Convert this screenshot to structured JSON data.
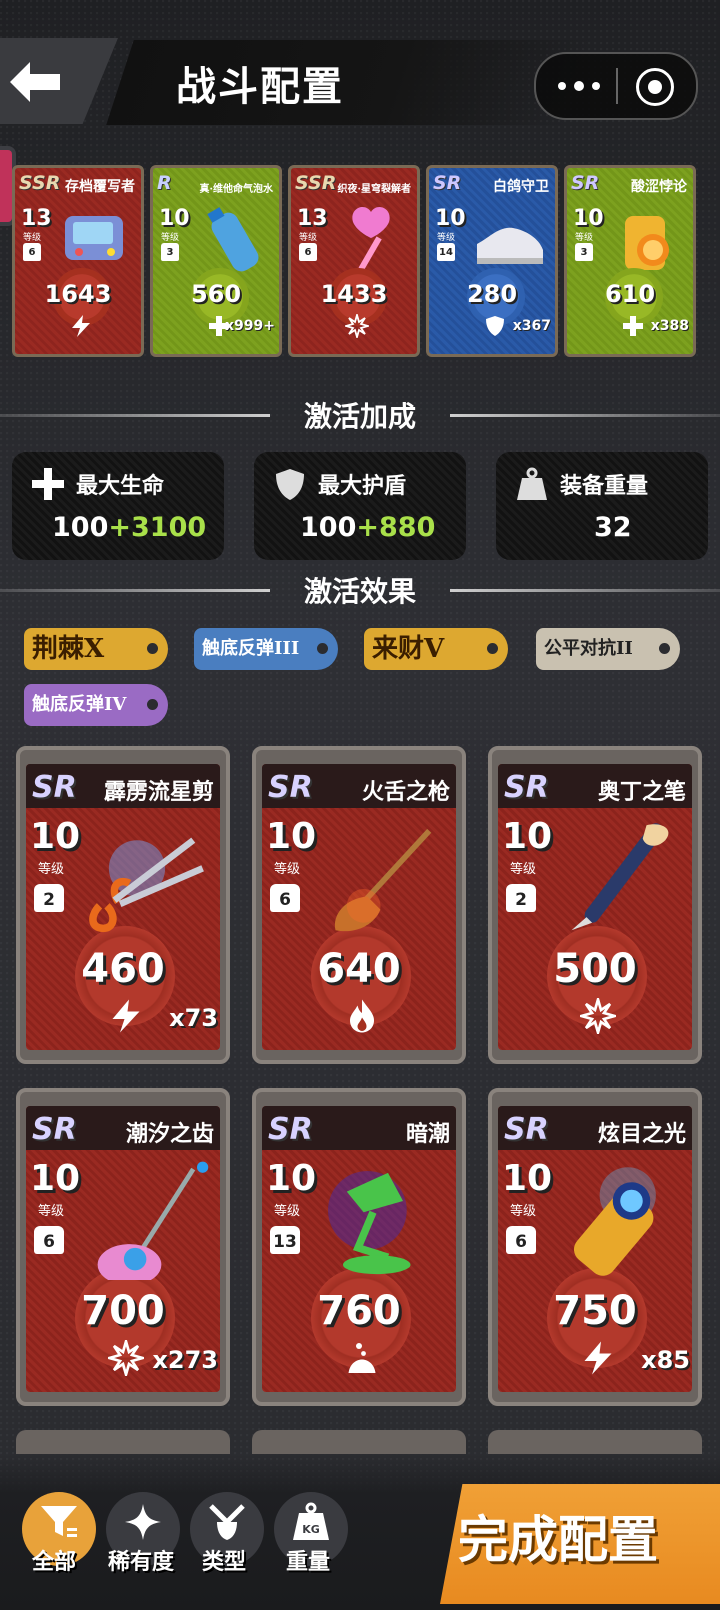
{
  "header": {
    "title": "战斗配置"
  },
  "equipped": [
    {
      "rarity": "SSR",
      "name": "存档覆写者",
      "level": "13",
      "level_label": "等级",
      "weight": "6",
      "value": "1643",
      "stat_icon": "lightning-icon",
      "count": "",
      "color": "red"
    },
    {
      "rarity": "R",
      "name": "真·维他命气泡水",
      "level": "10",
      "level_label": "等级",
      "weight": "3",
      "value": "560",
      "stat_icon": "plus-icon",
      "count": "x999+",
      "color": "green"
    },
    {
      "rarity": "SSR",
      "name": "织夜·星穹裂解者",
      "level": "13",
      "level_label": "等级",
      "weight": "6",
      "value": "1433",
      "stat_icon": "snowflake-icon",
      "count": "",
      "color": "red"
    },
    {
      "rarity": "SR",
      "name": "白鸽守卫",
      "level": "10",
      "level_label": "等级",
      "weight": "14",
      "value": "280",
      "stat_icon": "shield-icon",
      "count": "x367",
      "color": "blue"
    },
    {
      "rarity": "SR",
      "name": "酸涩悖论",
      "level": "10",
      "level_label": "等级",
      "weight": "3",
      "value": "610",
      "stat_icon": "plus-icon",
      "count": "x388",
      "color": "green"
    }
  ],
  "bonus_section": {
    "title": "激活加成"
  },
  "bonuses": [
    {
      "label": "最大生命",
      "base": "100",
      "plus": "+3100",
      "icon": "plus-icon"
    },
    {
      "label": "最大护盾",
      "base": "100",
      "plus": "+880",
      "icon": "shield-icon"
    },
    {
      "label": "装备重量",
      "base": "32",
      "plus": "",
      "icon": "weight-icon"
    }
  ],
  "effects_section": {
    "title": "激活效果"
  },
  "effects": [
    "荆棘X",
    "触底反弹III",
    "来财V",
    "公平对抗II",
    "触底反弹IV"
  ],
  "inventory": [
    {
      "rarity": "SR",
      "name": "霹雳流星剪",
      "level": "10",
      "level_label": "等级",
      "weight": "2",
      "value": "460",
      "stat_icon": "lightning-icon",
      "count": "x73"
    },
    {
      "rarity": "SR",
      "name": "火舌之枪",
      "level": "10",
      "level_label": "等级",
      "weight": "6",
      "value": "640",
      "stat_icon": "flame-icon",
      "count": ""
    },
    {
      "rarity": "SR",
      "name": "奥丁之笔",
      "level": "10",
      "level_label": "等级",
      "weight": "2",
      "value": "500",
      "stat_icon": "snowflake-icon",
      "count": ""
    },
    {
      "rarity": "SR",
      "name": "潮汐之齿",
      "level": "10",
      "level_label": "等级",
      "weight": "6",
      "value": "700",
      "stat_icon": "snowflake-icon",
      "count": "x273"
    },
    {
      "rarity": "SR",
      "name": "暗潮",
      "level": "10",
      "level_label": "等级",
      "weight": "13",
      "value": "760",
      "stat_icon": "poison-icon",
      "count": ""
    },
    {
      "rarity": "SR",
      "name": "炫目之光",
      "level": "10",
      "level_label": "等级",
      "weight": "6",
      "value": "750",
      "stat_icon": "lightning-icon",
      "count": "x85"
    }
  ],
  "filters": [
    {
      "label": "全部",
      "icon": "filter-icon",
      "active": true
    },
    {
      "label": "稀有度",
      "icon": "sparkle-icon",
      "active": false
    },
    {
      "label": "类型",
      "icon": "swords-icon",
      "active": false
    },
    {
      "label": "重量",
      "icon": "weight-kg-icon",
      "active": false
    }
  ],
  "weight_icon_text": "KG",
  "done_button": {
    "label": "完成配置"
  },
  "colors": {
    "accent": "#e88a20",
    "plus_green": "#a9e04a",
    "card_red": "#9a2a22",
    "card_green": "#7da11f",
    "card_blue": "#2a5aa8"
  }
}
